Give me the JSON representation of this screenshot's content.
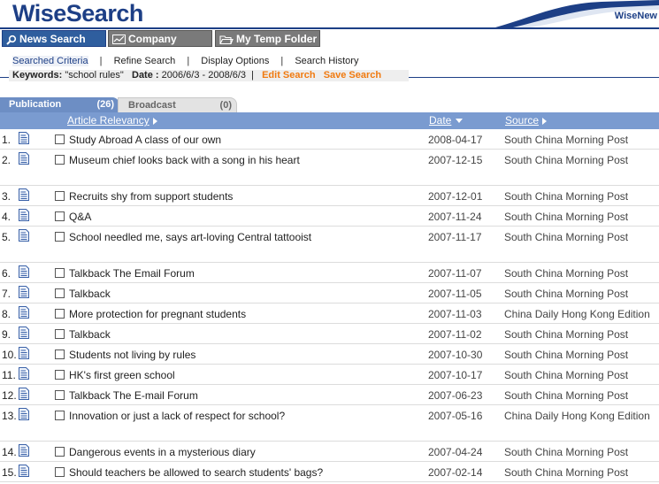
{
  "header": {
    "logo": "WiseSearch",
    "right_text": "WiseNew"
  },
  "tabs": [
    {
      "label": "News Search",
      "icon": "magnifier-icon"
    },
    {
      "label": "Company Search",
      "icon": "chart-icon"
    },
    {
      "label": "My Temp Folder",
      "icon": "folder-icon"
    }
  ],
  "subnav": {
    "searched_criteria": "Searched Criteria",
    "refine_search": "Refine Search",
    "display_options": "Display Options",
    "search_history": "Search History",
    "sep": "|"
  },
  "criteria": {
    "keywords_label": "Keywords:",
    "keywords_value": "\"school rules\"",
    "date_label": "Date :",
    "date_value": "2006/6/3 - 2008/6/3",
    "sep": "|",
    "edit_search": "Edit Search",
    "save_search": "Save Search"
  },
  "result_tabs": {
    "publication": {
      "label": "Publication",
      "count": "(26)"
    },
    "broadcast": {
      "label": "Broadcast",
      "count": "(0)"
    }
  },
  "columns": {
    "relevancy": "Article Relevancy",
    "date": "Date",
    "source": "Source"
  },
  "rows": [
    {
      "num": "1.",
      "title": "Study Abroad A class of our own",
      "date": "2008-04-17",
      "source": "South China Morning Post",
      "tall": false
    },
    {
      "num": "2.",
      "title": "Museum chief looks back with a song in his heart",
      "date": "2007-12-15",
      "source": "South China Morning Post",
      "tall": true
    },
    {
      "num": "3.",
      "title": "Recruits shy from support students",
      "date": "2007-12-01",
      "source": "South China Morning Post",
      "tall": false
    },
    {
      "num": "4.",
      "title": "Q&A",
      "date": "2007-11-24",
      "source": "South China Morning Post",
      "tall": false
    },
    {
      "num": "5.",
      "title": "School needled me, says art-loving Central tattooist",
      "date": "2007-11-17",
      "source": "South China Morning Post",
      "tall": true
    },
    {
      "num": "6.",
      "title": "Talkback The Email Forum",
      "date": "2007-11-07",
      "source": "South China Morning Post",
      "tall": false
    },
    {
      "num": "7.",
      "title": "Talkback",
      "date": "2007-11-05",
      "source": "South China Morning Post",
      "tall": false
    },
    {
      "num": "8.",
      "title": "More protection for pregnant students",
      "date": "2007-11-03",
      "source": "China Daily Hong Kong Edition",
      "tall": false
    },
    {
      "num": "9.",
      "title": "Talkback",
      "date": "2007-11-02",
      "source": "South China Morning Post",
      "tall": false
    },
    {
      "num": "10.",
      "title": "Students not living by rules",
      "date": "2007-10-30",
      "source": "South China Morning Post",
      "tall": false
    },
    {
      "num": "11.",
      "title": "HK's first green school",
      "date": "2007-10-17",
      "source": "South China Morning Post",
      "tall": false
    },
    {
      "num": "12.",
      "title": "Talkback The E-mail Forum",
      "date": "2007-06-23",
      "source": "South China Morning Post",
      "tall": false
    },
    {
      "num": "13.",
      "title": "Innovation or just a lack of respect for school?",
      "date": "2007-05-16",
      "source": "China Daily Hong Kong Edition",
      "tall": true
    },
    {
      "num": "14.",
      "title": "Dangerous events in a mysterious diary",
      "date": "2007-04-24",
      "source": "South China Morning Post",
      "tall": false
    },
    {
      "num": "15.",
      "title": "Should teachers be allowed to search students' bags?",
      "date": "2007-02-14",
      "source": "South China Morning Post",
      "tall": false
    }
  ]
}
